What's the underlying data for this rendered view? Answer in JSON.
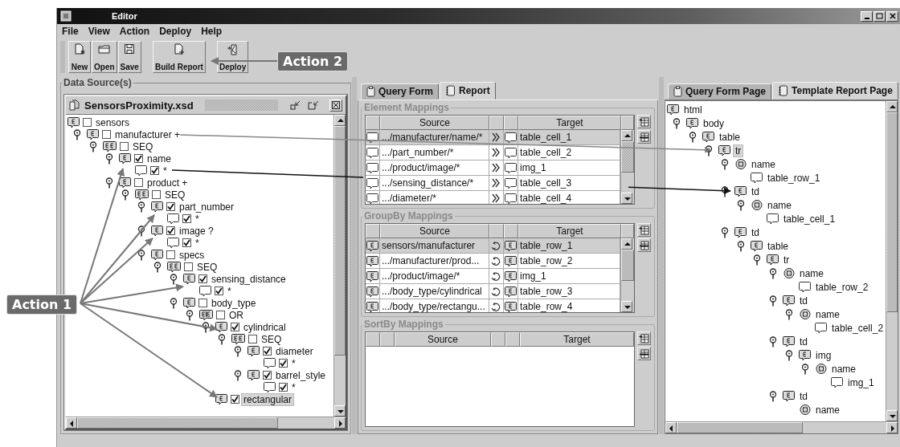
{
  "window": {
    "title": "Editor"
  },
  "menu": [
    "File",
    "View",
    "Action",
    "Deploy",
    "Help"
  ],
  "toolbar": {
    "groups": [
      {
        "buttons": [
          {
            "label": "New",
            "kind": "new"
          },
          {
            "label": "Open",
            "kind": "open"
          },
          {
            "label": "Save",
            "kind": "save"
          }
        ]
      },
      {
        "buttons": [
          {
            "label": "Build Report",
            "kind": "build"
          }
        ]
      },
      {
        "buttons": [
          {
            "label": "Deploy",
            "kind": "deploy"
          }
        ]
      }
    ]
  },
  "data_source": {
    "title": "Data Source(s)",
    "file": {
      "name": "SensorsProximity.xsd"
    },
    "tree": [
      {
        "label": "sensors",
        "kind": "element",
        "checked": false,
        "selected": false,
        "children": [
          {
            "label": "manufacturer +",
            "kind": "element",
            "checked": false,
            "selected": false,
            "children": [
              {
                "label": "SEQ",
                "kind": "group",
                "checked": false,
                "selected": false,
                "children": [
                  {
                    "label": "name",
                    "kind": "element",
                    "checked": true,
                    "selected": false,
                    "children": [
                      {
                        "label": "*",
                        "kind": "text",
                        "checked": true,
                        "selected": false
                      }
                    ]
                  },
                  {
                    "label": "product +",
                    "kind": "element",
                    "checked": false,
                    "selected": false,
                    "children": [
                      {
                        "label": "SEQ",
                        "kind": "group",
                        "checked": false,
                        "selected": false,
                        "children": [
                          {
                            "label": "part_number",
                            "kind": "element",
                            "checked": true,
                            "selected": false,
                            "children": [
                              {
                                "label": "*",
                                "kind": "text",
                                "checked": true,
                                "selected": false
                              }
                            ]
                          },
                          {
                            "label": "image ?",
                            "kind": "element",
                            "checked": true,
                            "selected": false,
                            "children": [
                              {
                                "label": "*",
                                "kind": "text",
                                "checked": true,
                                "selected": false
                              }
                            ]
                          },
                          {
                            "label": "specs",
                            "kind": "element",
                            "checked": false,
                            "selected": false,
                            "children": [
                              {
                                "label": "SEQ",
                                "kind": "group",
                                "checked": false,
                                "selected": false,
                                "children": [
                                  {
                                    "label": "sensing_distance",
                                    "kind": "element",
                                    "checked": true,
                                    "selected": false,
                                    "children": [
                                      {
                                        "label": "*",
                                        "kind": "text",
                                        "checked": true,
                                        "selected": false
                                      }
                                    ]
                                  },
                                  {
                                    "label": "body_type",
                                    "kind": "element",
                                    "checked": false,
                                    "selected": false,
                                    "children": [
                                      {
                                        "label": "OR",
                                        "kind": "choice",
                                        "checked": false,
                                        "selected": false,
                                        "children": [
                                          {
                                            "label": "cylindrical",
                                            "kind": "element",
                                            "checked": true,
                                            "selected": false,
                                            "children": [
                                              {
                                                "label": "SEQ",
                                                "kind": "group",
                                                "checked": false,
                                                "selected": false,
                                                "children": [
                                                  {
                                                    "label": "diameter",
                                                    "kind": "element",
                                                    "checked": true,
                                                    "selected": false,
                                                    "children": [
                                                      {
                                                        "label": "*",
                                                        "kind": "text",
                                                        "checked": true,
                                                        "selected": false
                                                      }
                                                    ]
                                                  },
                                                  {
                                                    "label": "barrel_style",
                                                    "kind": "element",
                                                    "checked": true,
                                                    "selected": false,
                                                    "children": [
                                                      {
                                                        "label": "*",
                                                        "kind": "text",
                                                        "checked": true,
                                                        "selected": false
                                                      }
                                                    ]
                                                  }
                                                ]
                                              }
                                            ]
                                          },
                                          {
                                            "label": "rectangular",
                                            "kind": "element",
                                            "checked": true,
                                            "selected": true
                                          }
                                        ]
                                      }
                                    ]
                                  }
                                ]
                              }
                            ]
                          }
                        ]
                      }
                    ]
                  }
                ]
              }
            ]
          }
        ]
      }
    ]
  },
  "mapping_panel": {
    "tabs": [
      {
        "label": "Query Form",
        "kind": "form",
        "selected": false
      },
      {
        "label": "Report",
        "kind": "report",
        "selected": true
      }
    ],
    "sections": [
      {
        "title": "Element Mappings",
        "kind": "mapping",
        "columns": [
          "Source",
          "Target"
        ],
        "rows": [
          {
            "source": {
              "kind": "text",
              "label": ".../manufacturer/name/*"
            },
            "link": {
              "kind": "map"
            },
            "target": {
              "kind": "text",
              "label": "table_cell_1"
            },
            "selected": true
          },
          {
            "source": {
              "kind": "text",
              "label": ".../part_number/*"
            },
            "link": {
              "kind": "map"
            },
            "target": {
              "kind": "text",
              "label": "table_cell_2"
            },
            "selected": false
          },
          {
            "source": {
              "kind": "text",
              "label": ".../product/image/*"
            },
            "link": {
              "kind": "map"
            },
            "target": {
              "kind": "text",
              "label": "img_1"
            },
            "selected": false
          },
          {
            "source": {
              "kind": "text",
              "label": ".../sensing_distance/*"
            },
            "link": {
              "kind": "map"
            },
            "target": {
              "kind": "text",
              "label": "table_cell_3"
            },
            "selected": false
          },
          {
            "source": {
              "kind": "text",
              "label": ".../diameter/*"
            },
            "link": {
              "kind": "map"
            },
            "target": {
              "kind": "text",
              "label": "table_cell_4"
            },
            "selected": false
          }
        ]
      },
      {
        "title": "GroupBy Mappings",
        "kind": "mapping",
        "columns": [
          "Source",
          "Target"
        ],
        "rows": [
          {
            "source": {
              "kind": "element",
              "label": "sensors/manufacturer"
            },
            "link": {
              "kind": "group"
            },
            "target": {
              "kind": "element",
              "label": "table_row_1"
            },
            "selected": true
          },
          {
            "source": {
              "kind": "element",
              "label": ".../manufacturer/prod..."
            },
            "link": {
              "kind": "group"
            },
            "target": {
              "kind": "element",
              "label": "table_row_2"
            },
            "selected": false
          },
          {
            "source": {
              "kind": "element",
              "label": ".../product/image/*"
            },
            "link": {
              "kind": "group"
            },
            "target": {
              "kind": "element",
              "label": "img_1"
            },
            "selected": false
          },
          {
            "source": {
              "kind": "element",
              "label": ".../body_type/cylindrical"
            },
            "link": {
              "kind": "group"
            },
            "target": {
              "kind": "element",
              "label": "table_row_3"
            },
            "selected": false
          },
          {
            "source": {
              "kind": "element",
              "label": ".../body_type/rectangu..."
            },
            "link": {
              "kind": "group"
            },
            "target": {
              "kind": "element",
              "label": "table_row_4"
            },
            "selected": false
          }
        ]
      },
      {
        "title": "SortBy Mappings",
        "kind": "sort",
        "columns": [
          "Source",
          "Target"
        ]
      }
    ]
  },
  "template_panel": {
    "tabs": [
      {
        "label": "Query Form Page",
        "kind": "form",
        "selected": false
      },
      {
        "label": "Template Report Page",
        "kind": "report",
        "selected": true
      }
    ],
    "tree": [
      {
        "label": "html",
        "kind": "element",
        "selected": false,
        "children": [
          {
            "label": "body",
            "kind": "element",
            "selected": false,
            "children": [
              {
                "label": "table",
                "kind": "element",
                "selected": false,
                "children": [
                  {
                    "label": "tr",
                    "kind": "element",
                    "selected": true,
                    "children": [
                      {
                        "label": "name",
                        "kind": "attribute",
                        "selected": false,
                        "children": [
                          {
                            "label": "table_row_1",
                            "kind": "text",
                            "selected": false
                          }
                        ]
                      },
                      {
                        "label": "td",
                        "kind": "element",
                        "selected": false,
                        "children": [
                          {
                            "label": "name",
                            "kind": "attribute",
                            "selected": false,
                            "children": [
                              {
                                "label": "table_cell_1",
                                "kind": "text",
                                "selected": false
                              }
                            ]
                          }
                        ]
                      },
                      {
                        "label": "td",
                        "kind": "element",
                        "selected": false,
                        "children": [
                          {
                            "label": "table",
                            "kind": "element",
                            "selected": false,
                            "children": [
                              {
                                "label": "tr",
                                "kind": "element",
                                "selected": false,
                                "children": [
                                  {
                                    "label": "name",
                                    "kind": "attribute",
                                    "selected": false,
                                    "children": [
                                      {
                                        "label": "table_row_2",
                                        "kind": "text",
                                        "selected": false
                                      }
                                    ]
                                  },
                                  {
                                    "label": "td",
                                    "kind": "element",
                                    "selected": false,
                                    "children": [
                                      {
                                        "label": "name",
                                        "kind": "attribute",
                                        "selected": false,
                                        "children": [
                                          {
                                            "label": "table_cell_2",
                                            "kind": "text",
                                            "selected": false
                                          }
                                        ]
                                      }
                                    ]
                                  },
                                  {
                                    "label": "td",
                                    "kind": "element",
                                    "selected": false,
                                    "children": [
                                      {
                                        "label": "img",
                                        "kind": "element",
                                        "selected": false,
                                        "children": [
                                          {
                                            "label": "name",
                                            "kind": "attribute",
                                            "selected": false,
                                            "children": [
                                              {
                                                "label": "img_1",
                                                "kind": "text",
                                                "selected": false
                                              }
                                            ]
                                          }
                                        ]
                                      }
                                    ]
                                  },
                                  {
                                    "label": "td",
                                    "kind": "element",
                                    "selected": false,
                                    "children": [
                                      {
                                        "label": "name",
                                        "kind": "attribute",
                                        "selected": false
                                      }
                                    ]
                                  }
                                ]
                              }
                            ]
                          }
                        ]
                      }
                    ]
                  }
                ]
              }
            ]
          }
        ]
      }
    ]
  },
  "annotations": [
    {
      "label": "Action 1"
    },
    {
      "label": "Action 2"
    }
  ]
}
